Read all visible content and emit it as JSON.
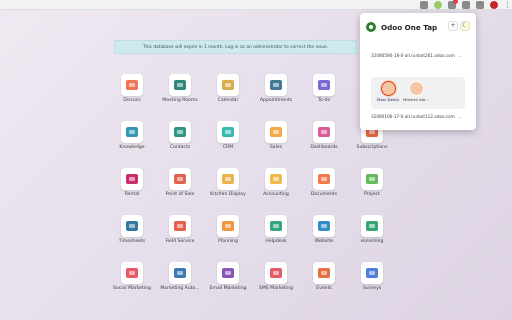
{
  "banner": {
    "text": "This database will expire in 1 month. Log in as an administrator to correct the issue."
  },
  "apps": [
    {
      "label": "Discuss",
      "icon": "discuss-icon",
      "color": "#f06543"
    },
    {
      "label": "Meeting Rooms",
      "icon": "meeting-rooms-icon",
      "color": "#1a7a6b"
    },
    {
      "label": "Calendar",
      "icon": "calendar-icon",
      "color": "#d4a23a"
    },
    {
      "label": "Appointments",
      "icon": "appointments-icon",
      "color": "#2f6b8a"
    },
    {
      "label": "To-do",
      "icon": "todo-icon",
      "color": "#6a5acd"
    },
    {
      "label": "",
      "icon": "",
      "color": ""
    },
    {
      "label": "",
      "icon": "",
      "color": ""
    },
    {
      "label": "Knowledge",
      "icon": "knowledge-icon",
      "color": "#1f8cae"
    },
    {
      "label": "Contacts",
      "icon": "contacts-icon",
      "color": "#1d8a78"
    },
    {
      "label": "CRM",
      "icon": "crm-icon",
      "color": "#24b3a6"
    },
    {
      "label": "Sales",
      "icon": "sales-icon",
      "color": "#f1a134"
    },
    {
      "label": "Dashboards",
      "icon": "dashboards-icon",
      "color": "#d44b8a"
    },
    {
      "label": "Subscriptions",
      "icon": "subscriptions-icon",
      "color": "#e7572f"
    },
    {
      "label": "",
      "icon": "",
      "color": ""
    },
    {
      "label": "Rental",
      "icon": "rental-icon",
      "color": "#c2185b"
    },
    {
      "label": "Point of Sale",
      "icon": "point-of-sale-icon",
      "color": "#d9533a"
    },
    {
      "label": "Kitchen Display",
      "icon": "kitchen-display-icon",
      "color": "#e9a93a"
    },
    {
      "label": "Accounting",
      "icon": "accounting-icon",
      "color": "#f0b23c"
    },
    {
      "label": "Documents",
      "icon": "documents-icon",
      "color": "#f06c3c"
    },
    {
      "label": "Project",
      "icon": "project-icon",
      "color": "#56b24a"
    },
    {
      "label": "",
      "icon": "",
      "color": ""
    },
    {
      "label": "Timesheets",
      "icon": "timesheets-icon",
      "color": "#1f6c93"
    },
    {
      "label": "Field Service",
      "icon": "field-service-icon",
      "color": "#e54b3c"
    },
    {
      "label": "Planning",
      "icon": "planning-icon",
      "color": "#f08a2c"
    },
    {
      "label": "Helpdesk",
      "icon": "helpdesk-icon",
      "color": "#1d9b74"
    },
    {
      "label": "Website",
      "icon": "website-icon",
      "color": "#1c7fc2"
    },
    {
      "label": "eLearning",
      "icon": "elearning-icon",
      "color": "#1f9c62"
    },
    {
      "label": "",
      "icon": "",
      "color": ""
    },
    {
      "label": "Social Marketing",
      "icon": "social-marketing-icon",
      "color": "#e64553"
    },
    {
      "label": "Marketing Auto...",
      "icon": "marketing-automation-icon",
      "color": "#2a6aa8"
    },
    {
      "label": "Email Marketing",
      "icon": "email-marketing-icon",
      "color": "#7e3fb1"
    },
    {
      "label": "SMS Marketing",
      "icon": "sms-marketing-icon",
      "color": "#e14a5a"
    },
    {
      "label": "Events",
      "icon": "events-icon",
      "color": "#e3612b"
    },
    {
      "label": "Surveys",
      "icon": "surveys-icon",
      "color": "#3f6fd6"
    },
    {
      "label": "",
      "icon": "",
      "color": ""
    }
  ],
  "popup": {
    "title": "Odoo One Tap",
    "add_label": "+",
    "db1": "32080590-18-0-all.runbot261.odoo.com",
    "db2": "32080106-17-0-all.runbot112.odoo.com",
    "users": [
      {
        "name": "Marc Demo",
        "active": true
      },
      {
        "name": "Mitchell Adr...",
        "active": false
      }
    ]
  }
}
